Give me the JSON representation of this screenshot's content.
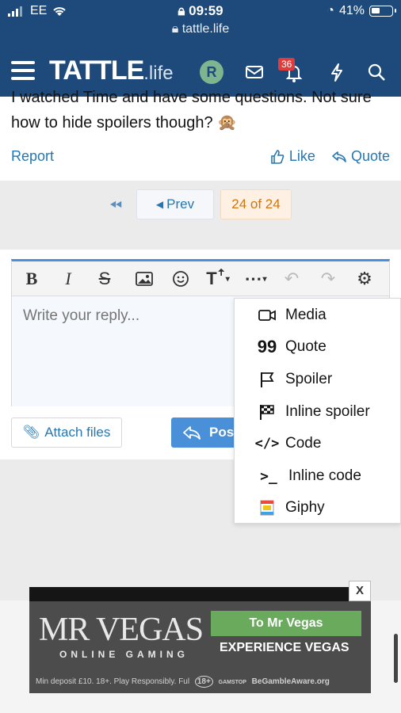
{
  "status_bar": {
    "carrier": "EE",
    "time": "09:59",
    "battery": "41%",
    "url": "tattle.life"
  },
  "header": {
    "logo_main": "TATTLE",
    "logo_sub": ".life",
    "avatar_letter": "R",
    "alert_count": "36"
  },
  "post": {
    "partial_line": "I watched Time and have some questions. Not sure",
    "text": "how to hide spoilers though? 🙊",
    "report_label": "Report",
    "like_label": "Like",
    "quote_label": "Quote"
  },
  "pagination": {
    "prev_label": "Prev",
    "current_label": "24 of 24"
  },
  "editor": {
    "placeholder": "Write your reply...",
    "attach_label": "Attach files",
    "post_label": "Post"
  },
  "insert_menu": {
    "items": [
      {
        "label": "Media",
        "icon": "video-icon"
      },
      {
        "label": "Quote",
        "icon": "quote-icon"
      },
      {
        "label": "Spoiler",
        "icon": "flag-icon"
      },
      {
        "label": "Inline spoiler",
        "icon": "checkered-flag-icon"
      },
      {
        "label": "Code",
        "icon": "code-icon"
      },
      {
        "label": "Inline code",
        "icon": "terminal-icon"
      },
      {
        "label": "Giphy",
        "icon": "giphy-icon"
      }
    ]
  },
  "ad": {
    "close_label": "X",
    "brand": "MR VEGAS",
    "brand_sub": "ONLINE GAMING",
    "cta": "To Mr Vegas",
    "tagline": "EXPERIENCE VEGAS",
    "fine_print": "Min deposit £10. 18+. Play Responsibly. Ful",
    "age_badge": "18+",
    "gamstop": "GAMSTOP",
    "begamble": "BeGambleAware.org"
  },
  "colors": {
    "header_bg": "#1d4a7a",
    "link": "#2577b1",
    "accent": "#4a90d9",
    "current_page": "#d1750f",
    "badge": "#e23b3b"
  }
}
